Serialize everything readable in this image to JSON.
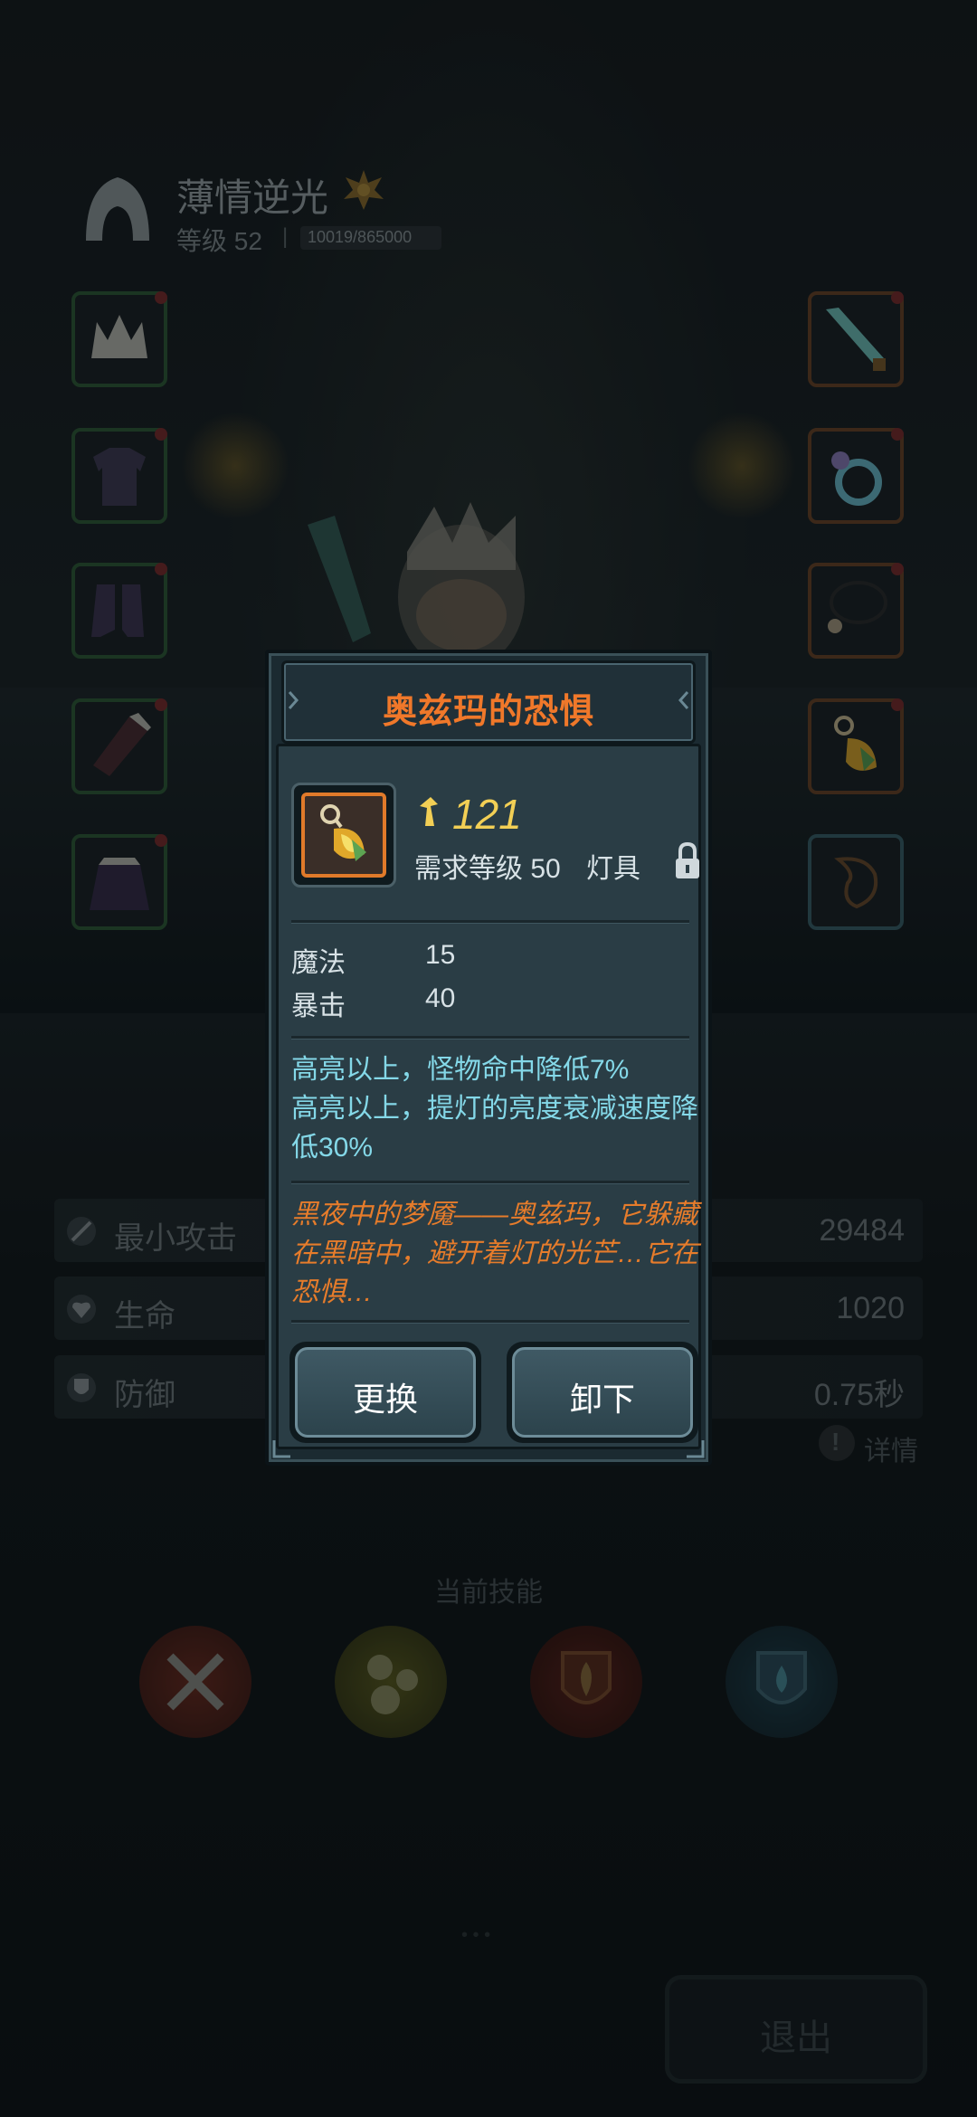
{
  "player": {
    "name": "薄情逆光",
    "level": "等级 52",
    "separator": "|",
    "xp": "10019/865000"
  },
  "equipment": {
    "left_slots": [
      "helmet-slot",
      "armor-slot",
      "boots-slot",
      "gloves-slot",
      "cloak-slot"
    ],
    "right_slots": [
      "weapon-slot",
      "ring-slot",
      "necklace-slot",
      "lamp-slot",
      "relic-slot"
    ]
  },
  "stats": [
    {
      "label": "最小攻击",
      "value": "29484",
      "icon": "sword-icon"
    },
    {
      "label": "生命",
      "value": "1020",
      "icon": "heart-icon"
    },
    {
      "label": "防御",
      "value": "0.75秒",
      "icon": "shield-icon"
    }
  ],
  "detail_label": "详情",
  "skills": {
    "title": "当前技能",
    "icons": [
      "crossed-axes-icon",
      "bubbles-icon",
      "flame-crest-icon",
      "water-drop-shield-icon"
    ]
  },
  "exit_label": "退出",
  "item_modal": {
    "title": "奥兹玛的恐惧",
    "power": "121",
    "required_level": "需求等级 50",
    "item_type": "灯具",
    "attributes": [
      {
        "name": "魔法",
        "value": "15"
      },
      {
        "name": "暴击",
        "value": "40"
      }
    ],
    "effects": [
      "高亮以上，怪物命中降低7%",
      "高亮以上，提灯的亮度衰减速度降低30%"
    ],
    "lore": "黑夜中的梦魇——奥兹玛，它躲藏在黑暗中，避开着灯的光芒…它在恐惧…",
    "replace_label": "更换",
    "unequip_label": "卸下"
  },
  "colors": {
    "title": "#f0782a",
    "power": "#f2cf55",
    "effect": "#84d8e8",
    "lore": "#e67c2b"
  }
}
